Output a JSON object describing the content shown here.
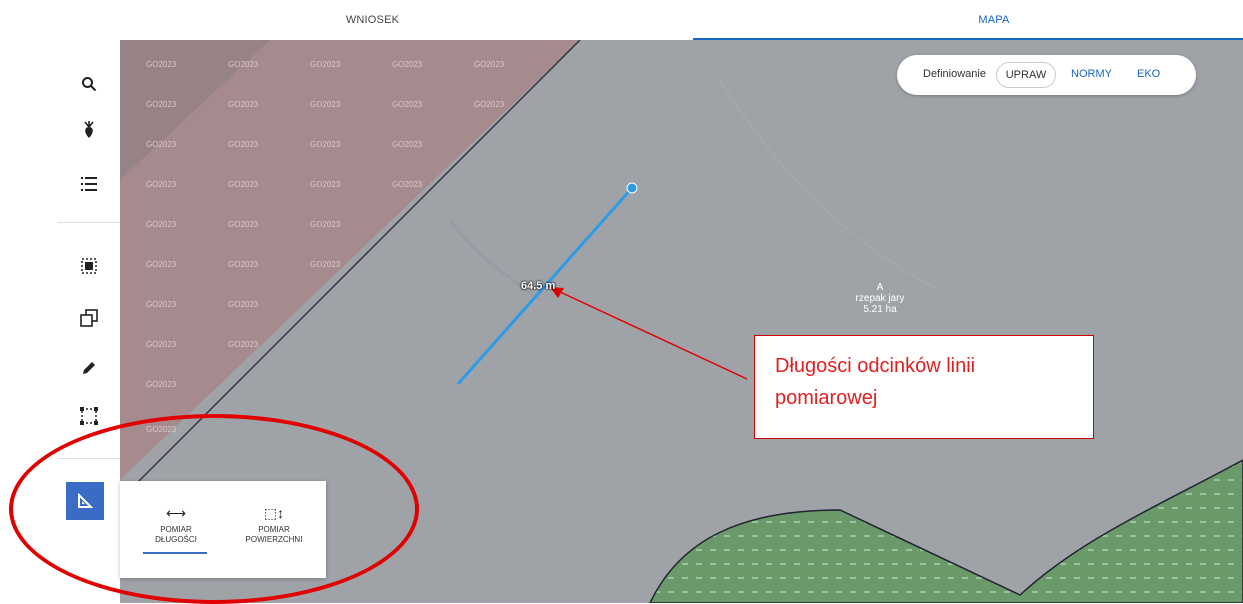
{
  "tabs": {
    "wniosek": "WNIOSEK",
    "mapa": "MAPA"
  },
  "toolbar": {
    "icons": [
      "search-icon",
      "crop-icon",
      "list-icon",
      "select-area-icon",
      "copy-shapes-icon",
      "pencil-icon",
      "bounding-box-icon",
      "measure-icon"
    ],
    "active_color": "#3a6bc5"
  },
  "pill": {
    "label": "Definiowanie",
    "upraw": "UPRAW",
    "normy": "NORMY",
    "eko": "EKO"
  },
  "map": {
    "watermark": "GO2023",
    "parcel": {
      "letter": "A",
      "crop": "rzepak jary",
      "area": "5.21 ha"
    },
    "measurement_label": "64.5 m"
  },
  "annotation": {
    "text": "Długości odcinków linii pomiarowej"
  },
  "popup": {
    "length_line1": "POMIAR",
    "length_line2": "DŁUGOŚCI",
    "area_line1": "POMIAR",
    "area_line2": "POWIERZCHNI"
  },
  "colors": {
    "accent": "#1565c0",
    "annotation": "#e00000",
    "measure_line": "#2e9be6"
  }
}
